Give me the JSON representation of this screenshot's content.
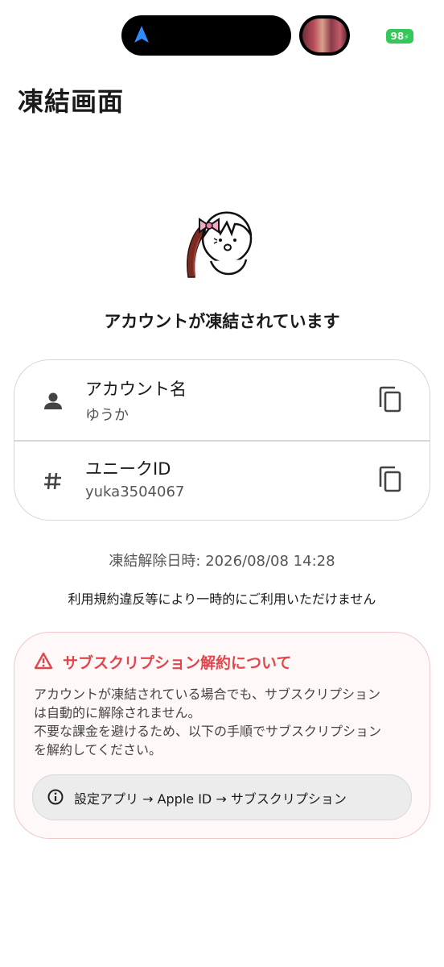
{
  "status_bar": {
    "battery": "98"
  },
  "page": {
    "title": "凍結画面",
    "frozen_message": "アカウントが凍結されています"
  },
  "account": {
    "name_label": "アカウント名",
    "name_value": "ゆうか",
    "id_label": "ユニークID",
    "id_value": "yuka3504067"
  },
  "unfreeze": {
    "text": "凍結解除日時: 2026/08/08 14:28"
  },
  "violation": {
    "text": "利用規約違反等により一時的にご利用いただけません"
  },
  "subscription": {
    "title": "サブスクリプション解約について",
    "line1": "アカウントが凍結されている場合でも、サブスクリプション",
    "line2": "は自動的に解除されません。",
    "line3": "不要な課金を避けるため、以下の手順でサブスクリプション",
    "line4": "を解約してください。",
    "path": "設定アプリ → Apple ID → サブスクリプション"
  },
  "colors": {
    "warning": "#e0474c",
    "battery": "#34c759",
    "nav_arrow": "#2f8cff"
  },
  "icons": {
    "nav": "navigation-arrow-icon",
    "person": "person-icon",
    "hash": "hash-icon",
    "copy": "copy-icon",
    "warning": "warning-triangle-icon",
    "info": "info-circle-icon"
  }
}
